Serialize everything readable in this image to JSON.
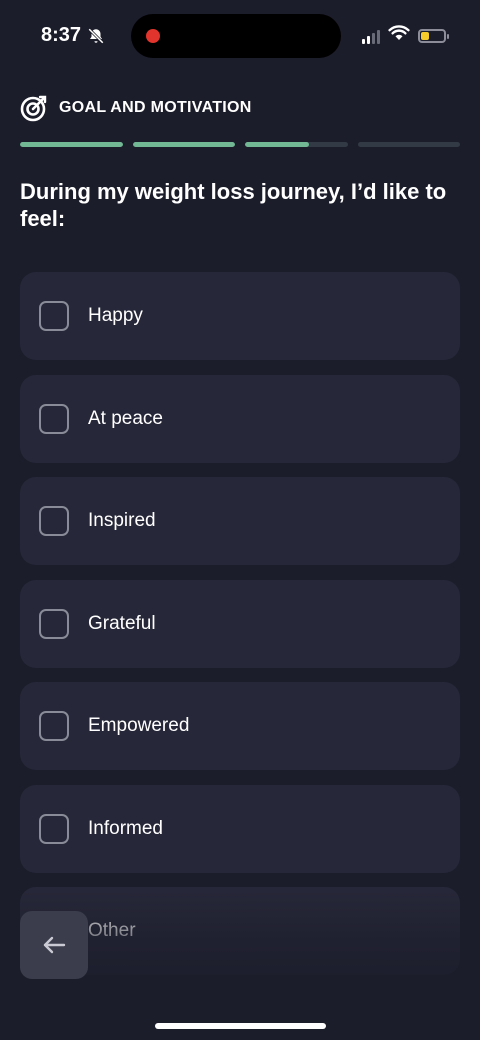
{
  "status_bar": {
    "time": "8:37",
    "icons": [
      "bell-off-icon",
      "signal-icon",
      "wifi-icon",
      "battery-icon"
    ],
    "battery_level": 0.35,
    "recording_color": "#e0342c"
  },
  "header": {
    "icon": "target-icon",
    "title": "GOAL AND MOTIVATION"
  },
  "progress": {
    "segments": [
      1,
      1,
      0.62,
      0
    ],
    "color": "#72b894"
  },
  "question": "During my weight loss journey, I’d like to feel:",
  "options": [
    {
      "label": "Happy",
      "checked": false
    },
    {
      "label": "At peace",
      "checked": false
    },
    {
      "label": "Inspired",
      "checked": false
    },
    {
      "label": "Grateful",
      "checked": false
    },
    {
      "label": "Empowered",
      "checked": false
    },
    {
      "label": "Informed",
      "checked": false
    },
    {
      "label": "Other",
      "checked": false
    }
  ],
  "navigation": {
    "back_icon": "arrow-left-icon"
  },
  "colors": {
    "background": "#1c1d2b",
    "card": "#262738",
    "accent": "#72b894"
  }
}
